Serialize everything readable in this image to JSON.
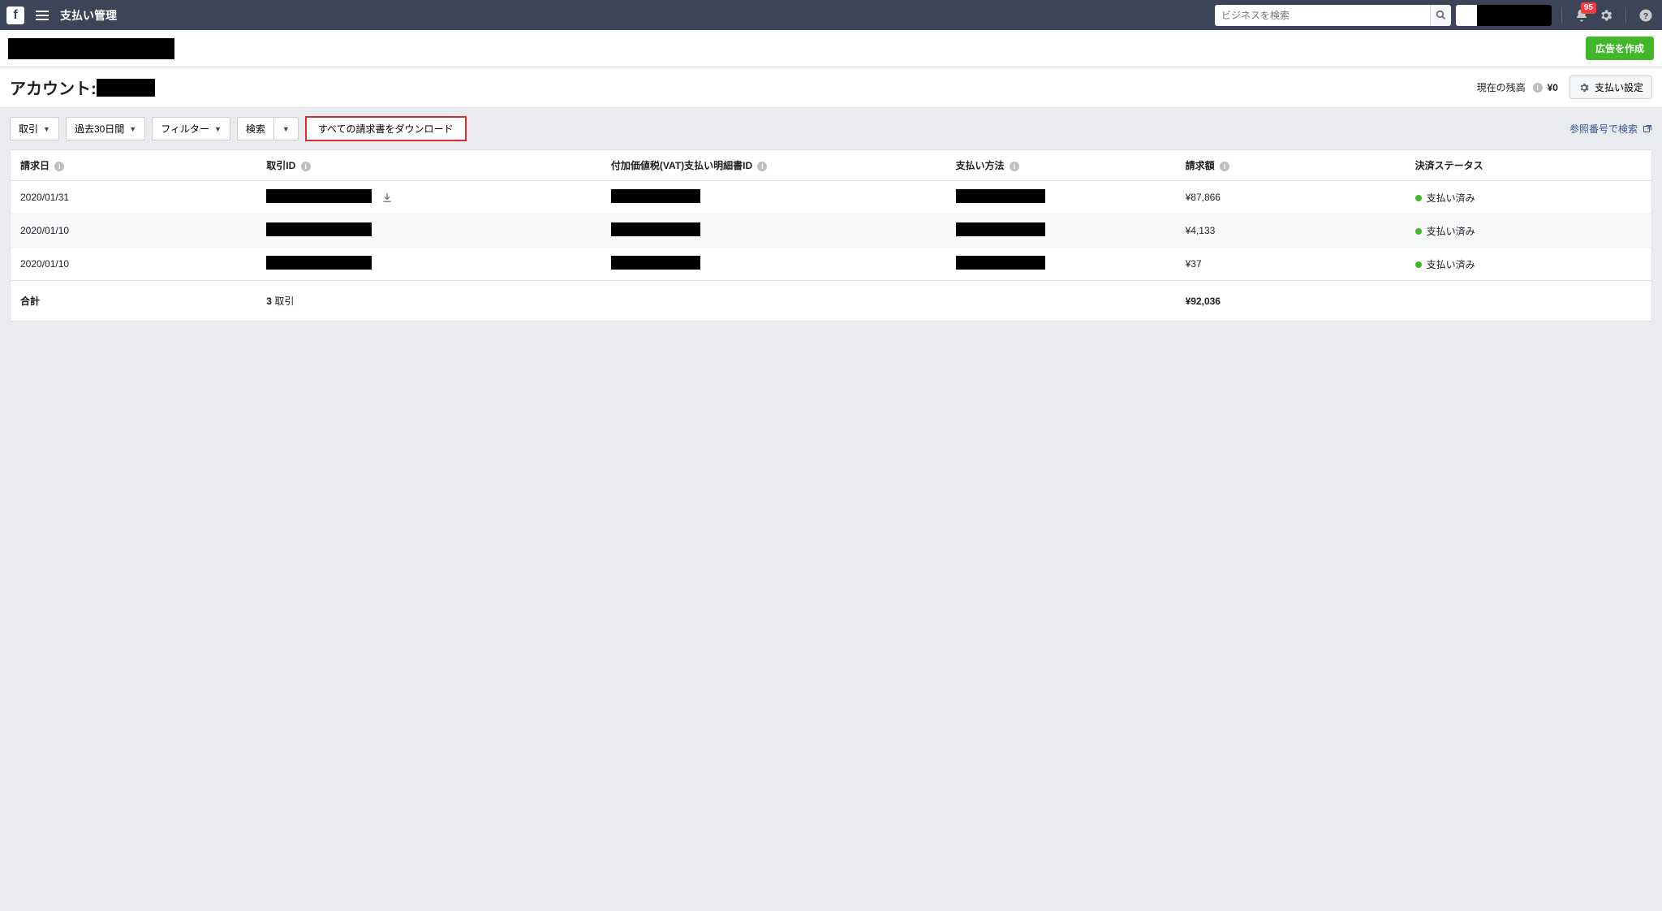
{
  "topnav": {
    "title": "支払い管理",
    "search_placeholder": "ビジネスを検索",
    "notification_count": "95"
  },
  "subheader": {
    "create_ad_label": "広告を作成"
  },
  "account_bar": {
    "label": "アカウント:",
    "balance_label": "現在の残高",
    "balance_value": "¥0",
    "payment_settings_label": "支払い設定"
  },
  "toolbar": {
    "transactions_label": "取引",
    "daterange_label": "過去30日間",
    "filter_label": "フィルター",
    "search_label": "検索",
    "download_all_label": "すべての請求書をダウンロード",
    "ref_search_label": "参照番号で検索"
  },
  "table": {
    "headers": {
      "invoice_date": "請求日",
      "transaction_id": "取引ID",
      "vat_statement_id": "付加価値税(VAT)支払い明細書ID",
      "payment_method": "支払い方法",
      "amount": "請求額",
      "status": "決済ステータス"
    },
    "rows": [
      {
        "date": "2020/01/31",
        "amount": "¥87,866",
        "status": "支払い済み",
        "has_download": true
      },
      {
        "date": "2020/01/10",
        "amount": "¥4,133",
        "status": "支払い済み",
        "has_download": false
      },
      {
        "date": "2020/01/10",
        "amount": "¥37",
        "status": "支払い済み",
        "has_download": false
      }
    ],
    "footer": {
      "total_label": "合計",
      "tx_count_num": "3",
      "tx_count_label": "取引",
      "total_amount": "¥92,036"
    }
  }
}
